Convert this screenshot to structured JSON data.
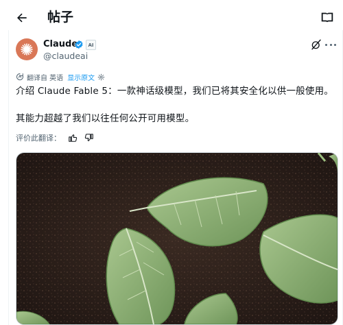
{
  "header": {
    "title": "帖子",
    "back_icon": "arrow-left-icon",
    "reader_icon": "book-open-icon"
  },
  "post": {
    "author": {
      "display_name": "Claude",
      "handle": "@claudeai",
      "verified_icon": "verified-badge-icon",
      "affiliate_badge": "AI",
      "avatar_color": "#d97757"
    },
    "translation_notice": {
      "label": "翻译自 英语",
      "show_original": "显示原文"
    },
    "text": "介绍 Claude Fable 5：一款神话级模型，我们已将其安全化以供一般使用。\n\n其能力超越了我们以往任何公开可用模型。",
    "rate_translation": "评价此翻译：",
    "media": {
      "subject_icon": "green-leaves-on-soil-photo"
    }
  },
  "colors": {
    "accent": "#1d9bf0",
    "text": "#0f1419",
    "secondary": "#536471"
  }
}
